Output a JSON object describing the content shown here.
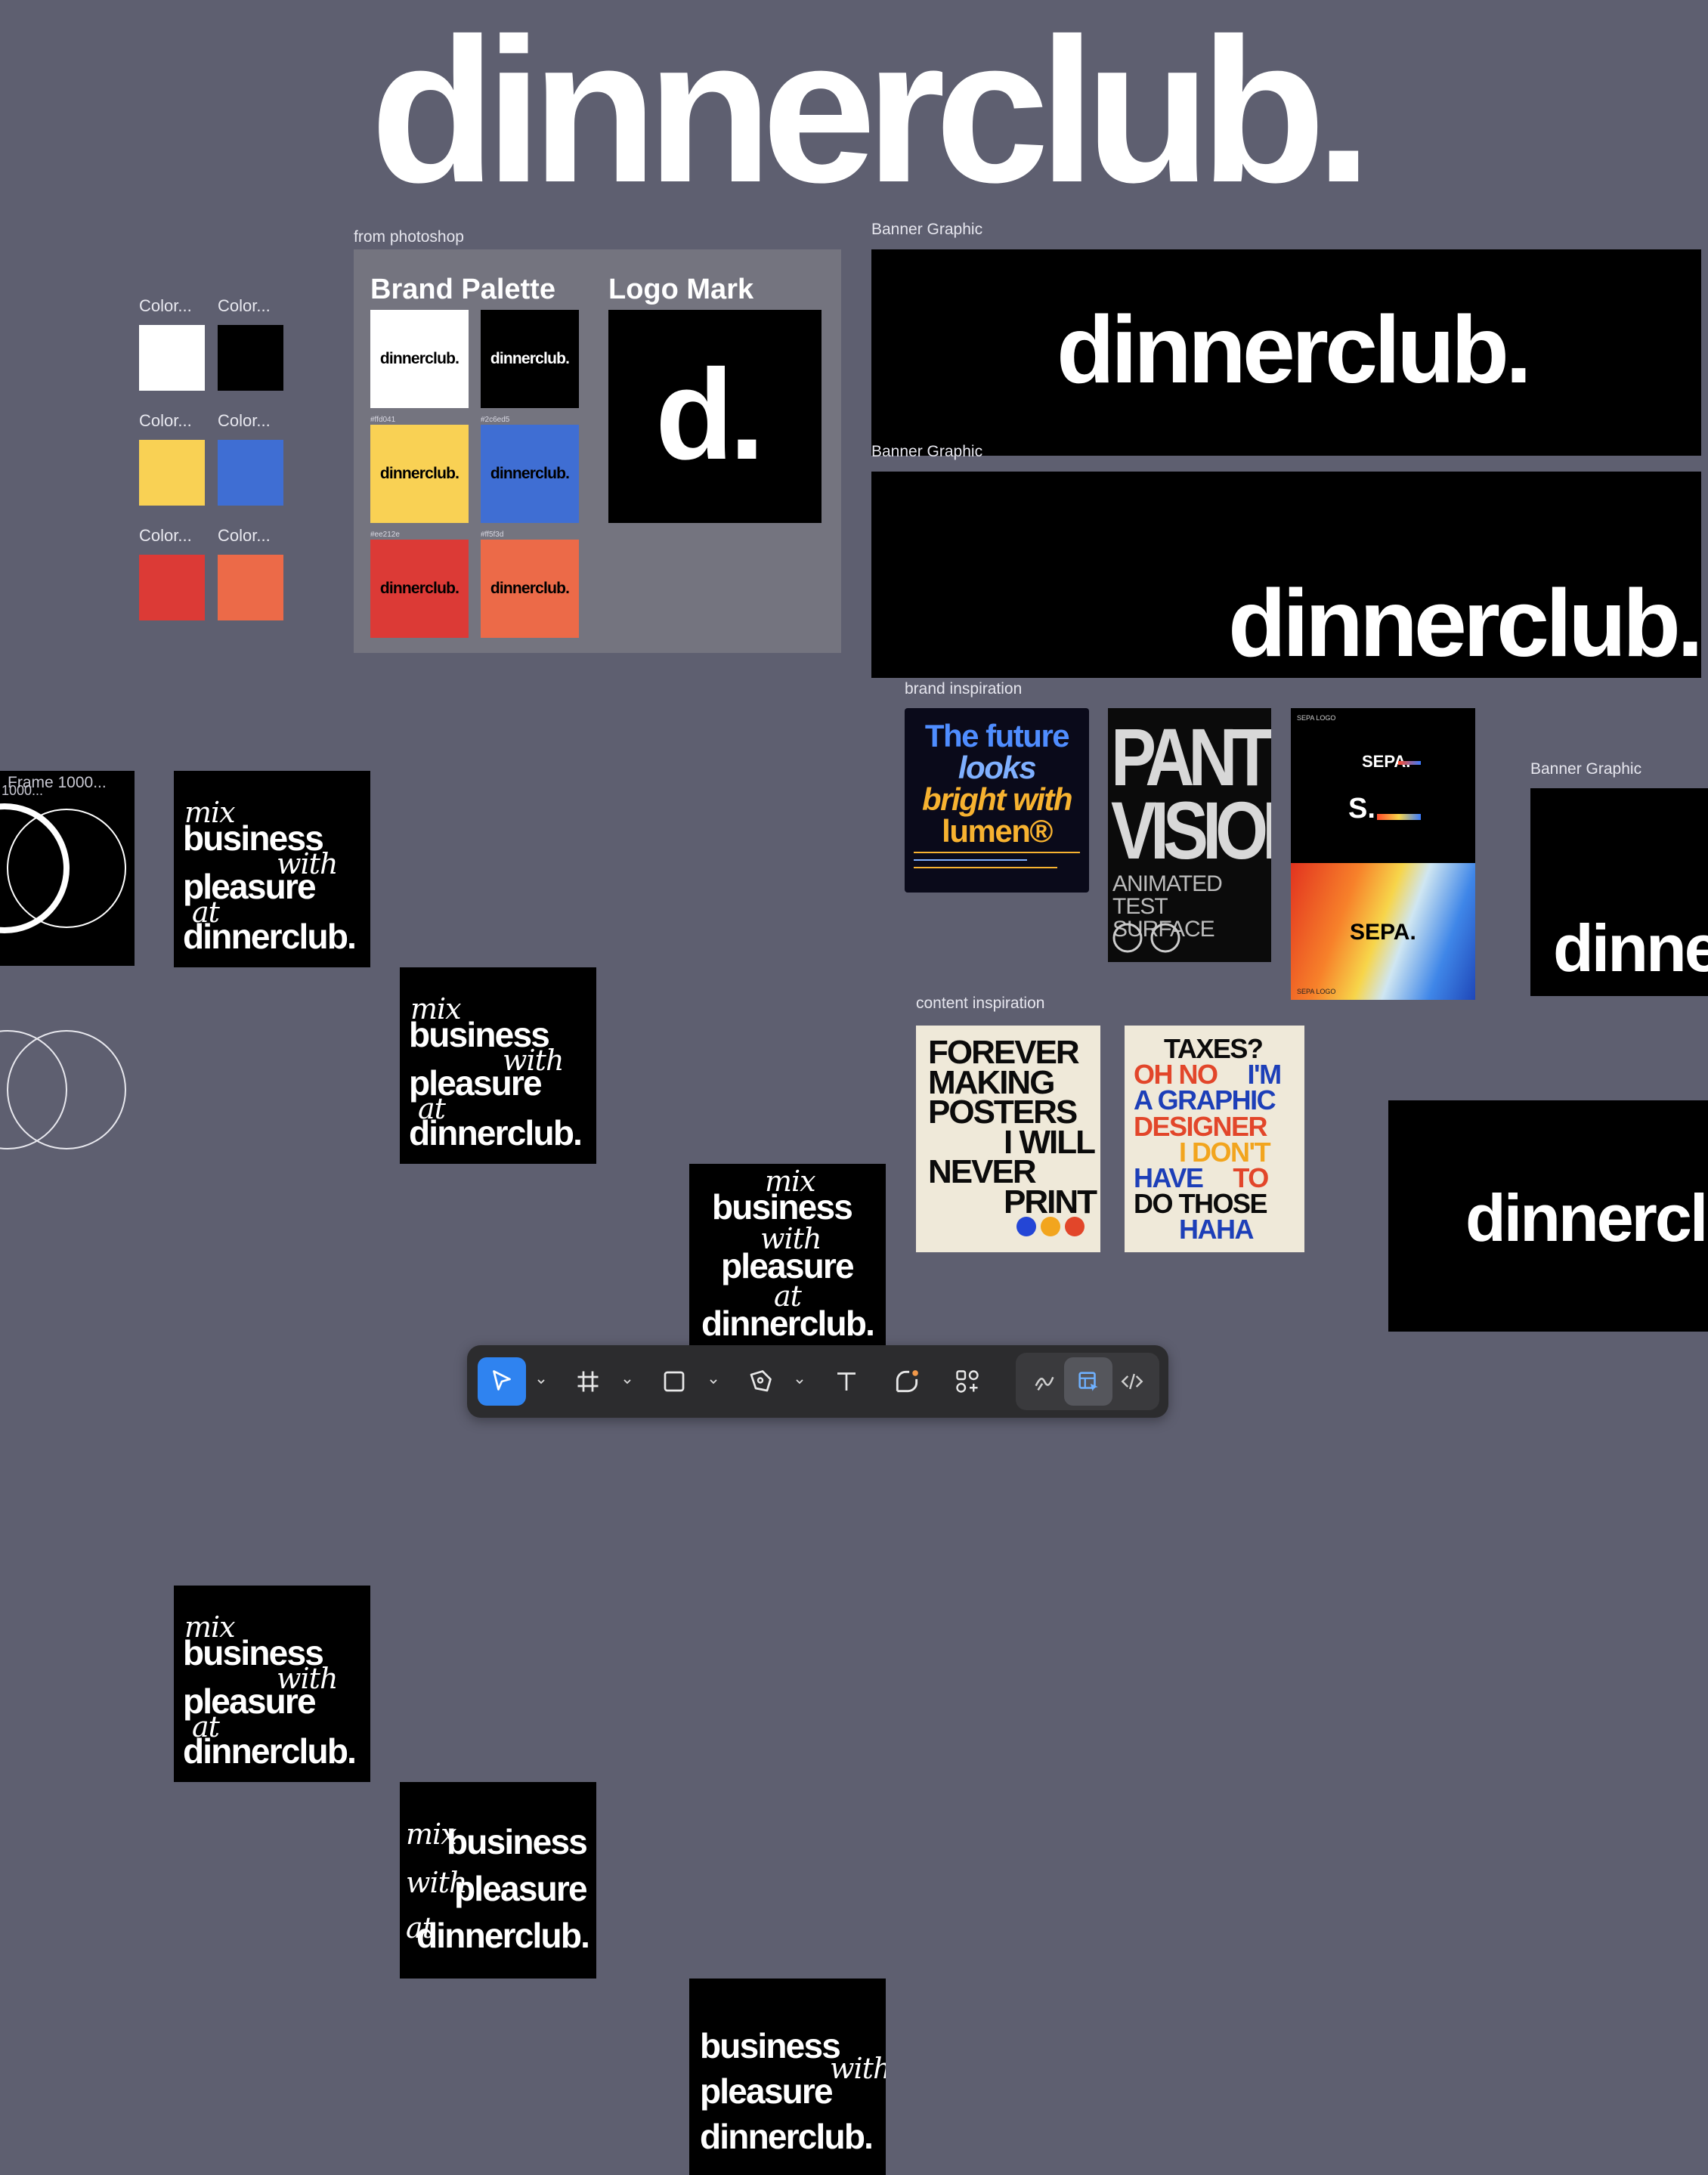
{
  "hero_title": "dinnerclub.",
  "frames": {
    "from_photoshop": "from photoshop",
    "banner_graphic_1": "Banner Graphic",
    "banner_graphic_2": "Banner Graphic",
    "banner_graphic_3": "Banner Graphic",
    "brand_inspiration": "brand inspiration",
    "content_inspiration": "content inspiration",
    "frame_partial": "Frame 1000...",
    "frame_partial_2": "1000..."
  },
  "swatches": [
    {
      "label": "Color...",
      "color": "#ffffff"
    },
    {
      "label": "Color...",
      "color": "#000000"
    },
    {
      "label": "Color...",
      "color": "#f9d154"
    },
    {
      "label": "Color...",
      "color": "#3f6ed3"
    },
    {
      "label": "Color...",
      "color": "#dc3a36"
    },
    {
      "label": "Color...",
      "color": "#ec6a48"
    }
  ],
  "brand_palette": {
    "title": "Brand Palette",
    "word": "dinnerclub.",
    "hex_labels": [
      "#ffd041",
      "#2c6ed5",
      "#ee212e",
      "#ff5f3d"
    ],
    "tiles": [
      {
        "bg": "#ffffff",
        "fg": "#000000"
      },
      {
        "bg": "#000000",
        "fg": "#ffffff"
      },
      {
        "bg": "#f9d154",
        "fg": "#000000"
      },
      {
        "bg": "#3f6ed3",
        "fg": "#000000"
      },
      {
        "bg": "#dc3a36",
        "fg": "#000000"
      },
      {
        "bg": "#ec6a48",
        "fg": "#000000"
      }
    ]
  },
  "logo_mark": {
    "title": "Logo Mark",
    "mark": "d."
  },
  "banners": {
    "word": "dinnerclub.",
    "partial_1": "dinne",
    "partial_2": "dinnerclu"
  },
  "posters": {
    "mix": "mix",
    "business": "business",
    "with": "with",
    "pleasure": "pleasure",
    "at": "at",
    "dinnerclub": "dinnerclub."
  },
  "inspiration": {
    "lumen_headline": [
      "The future",
      "looks",
      "bright with",
      "lumen®"
    ],
    "panter": [
      "PANTER",
      "VISION",
      "ANIMATED",
      "TEST SURFACE"
    ],
    "sepa": [
      "SEPA.",
      "S.",
      "SEPA.",
      "SEPA LOGO",
      "SEPA LOGO"
    ],
    "forever": [
      "FOREVER",
      "MAKING",
      "POSTERS",
      "I WILL",
      "NEVER",
      "PRINT"
    ],
    "taxes": [
      "TAXES?",
      "OH NO",
      "I'M",
      "A GRAPHIC",
      "DESIGNER",
      "I DON'T",
      "HAVE",
      "TO",
      "DO THOSE",
      "HAHA"
    ]
  },
  "toolbar": {
    "tools": [
      "move-tool",
      "frame-tool",
      "rectangle-tool",
      "pen-tool",
      "text-tool",
      "comment-tool",
      "actions-tool",
      "draw-mode",
      "design-mode",
      "dev-mode"
    ],
    "accent": "#2f83f0"
  }
}
